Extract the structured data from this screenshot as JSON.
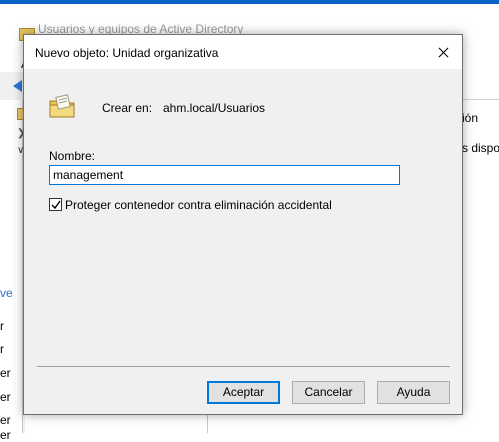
{
  "background_window": {
    "title": "Usuarios y equipos de Active Directory",
    "menu_first_letter": "A",
    "tree_fragments": [
      "ve",
      "r",
      "r",
      "er",
      "er",
      "er",
      "er"
    ],
    "right_fragments": [
      "ión",
      "s dispo"
    ]
  },
  "dialog": {
    "title": "Nuevo objeto: Unidad organizativa",
    "icon": "organizational-unit-icon",
    "create_in_label": "Crear en:",
    "create_in_value": "ahm.local/Usuarios",
    "name_label": "Nombre:",
    "name_value": "management",
    "protect_checkbox_label": "Proteger contenedor contra eliminación accidental",
    "protect_checked": true,
    "buttons": {
      "ok": "Aceptar",
      "cancel": "Cancelar",
      "help": "Ayuda"
    }
  },
  "colors": {
    "accent": "#0078d7",
    "dialog_bg": "#f0f0f0",
    "button_bg": "#e1e1e1"
  }
}
